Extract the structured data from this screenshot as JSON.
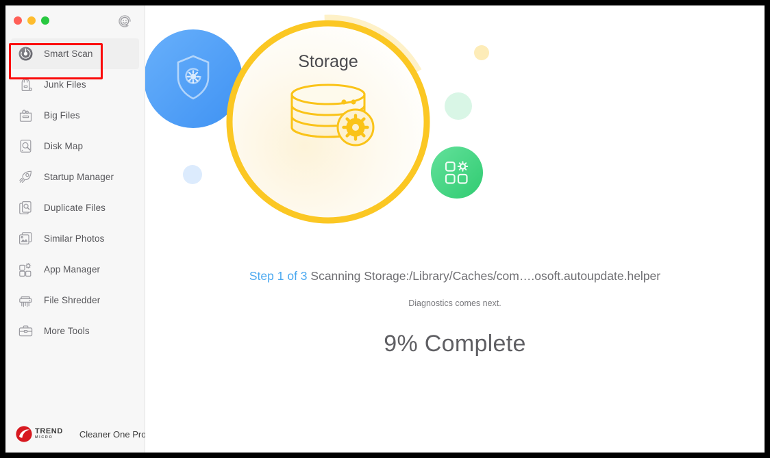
{
  "window": {
    "traffic_lights": [
      {
        "name": "close",
        "color": "#ff5f57"
      },
      {
        "name": "minimize",
        "color": "#febc2e"
      },
      {
        "name": "maximize",
        "color": "#28c840"
      }
    ],
    "feedback_icon": "smiley-feedback-icon"
  },
  "sidebar": {
    "items": [
      {
        "label": "Smart Scan",
        "icon": "smart-scan-icon",
        "selected": true
      },
      {
        "label": "Junk Files",
        "icon": "junk-files-icon",
        "selected": false
      },
      {
        "label": "Big Files",
        "icon": "big-files-icon",
        "selected": false
      },
      {
        "label": "Disk Map",
        "icon": "disk-map-icon",
        "selected": false
      },
      {
        "label": "Startup Manager",
        "icon": "startup-manager-icon",
        "selected": false
      },
      {
        "label": "Duplicate Files",
        "icon": "duplicate-files-icon",
        "selected": false
      },
      {
        "label": "Similar Photos",
        "icon": "similar-photos-icon",
        "selected": false
      },
      {
        "label": "App Manager",
        "icon": "app-manager-icon",
        "selected": false
      },
      {
        "label": "File Shredder",
        "icon": "file-shredder-icon",
        "selected": false
      },
      {
        "label": "More Tools",
        "icon": "more-tools-icon",
        "selected": false
      }
    ],
    "brand": {
      "logo": "trend-micro-logo",
      "company_line1": "TREND",
      "company_line2": "MICRO",
      "product": "Cleaner One Pro"
    },
    "selection_highlight_color": "#fb0b0b"
  },
  "main": {
    "hero": {
      "ring_label": "Storage",
      "ring_color": "#fbc723",
      "ring_track_color": "#fde9a4",
      "center_icon": "database-storage-gear-icon",
      "badges": [
        {
          "name": "shield-gear-badge",
          "color": "#4a9bf5",
          "icon": "shield-gear-icon"
        },
        {
          "name": "app-grid-gear-badge",
          "color": "#41d67f",
          "icon": "app-grid-gear-icon"
        }
      ],
      "dots": [
        {
          "name": "dot-yellow",
          "color": "#fdecb8"
        },
        {
          "name": "dot-green",
          "color": "#d2f4e0"
        },
        {
          "name": "dot-blue",
          "color": "#dbeafd"
        }
      ]
    },
    "status": {
      "step_label": "Step 1 of 3",
      "scan_path": " Scanning Storage:/Library/Caches/com….osoft.autoupdate.helper",
      "next_step": "Diagnostics comes next.",
      "progress_text": "9% Complete",
      "progress_percent": 9,
      "step_color": "#4aa8f0"
    }
  }
}
